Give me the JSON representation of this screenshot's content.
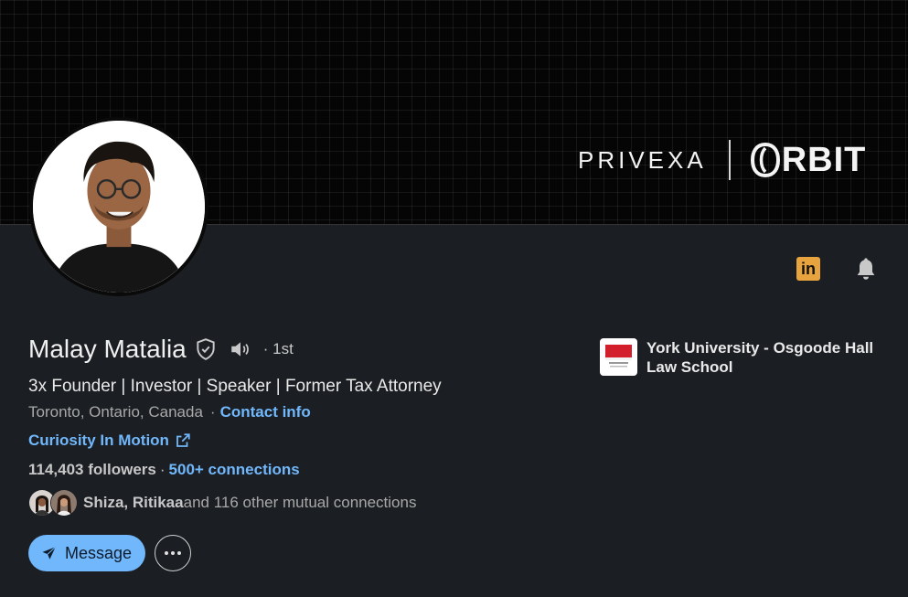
{
  "banner": {
    "brand_left": "PRIVEXA",
    "brand_right": "RBIT"
  },
  "profile": {
    "name": "Malay Matalia",
    "degree": "· 1st",
    "headline": "3x Founder | Investor | Speaker | Former Tax Attorney",
    "location": "Toronto, Ontario, Canada",
    "location_sep": "·",
    "contact_info": "Contact info",
    "website": "Curiosity In Motion",
    "followers": "114,403 followers",
    "stats_sep": "·",
    "connections": "500+ connections",
    "mutual_names": "Shiza, Ritikaa",
    "mutual_rest": " and 116 other mutual connections"
  },
  "education": {
    "school": "York University - Osgoode Hall Law School",
    "logo_top": "OSGOODE",
    "logo_bottom": "OSGOODE HALL LAW SCHOOL"
  },
  "actions": {
    "message_label": "Message"
  },
  "colors": {
    "accent": "#71b7fb",
    "background": "#1b1f23",
    "linkedin_badge": "#e7a33e"
  },
  "icons": [
    "linkedin-icon",
    "bell-icon",
    "verified-icon",
    "speaker-icon",
    "external-link-icon",
    "send-icon",
    "more-icon"
  ]
}
